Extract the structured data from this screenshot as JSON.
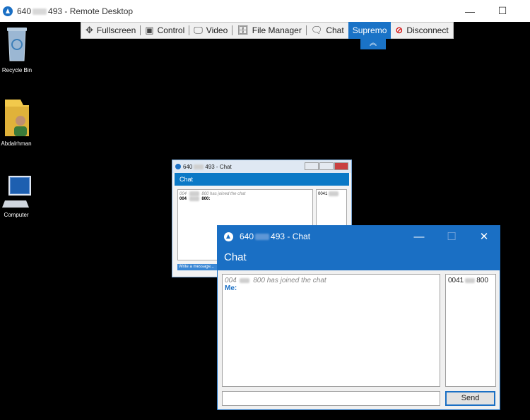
{
  "window": {
    "title_prefix": "640",
    "title_suffix": "493 - Remote Desktop",
    "minimize": "—",
    "maximize": "☐"
  },
  "toolbar": {
    "items": [
      {
        "icon": "move-icon",
        "glyph": "✥",
        "label": "Fullscreen"
      },
      {
        "icon": "control-icon",
        "glyph": "▣",
        "label": "Control"
      },
      {
        "icon": "monitor-icon",
        "glyph": "🖵",
        "label": "Video"
      },
      {
        "icon": "file-manager-icon",
        "glyph": "🗄",
        "label": "File Manager"
      },
      {
        "icon": "chat-icon",
        "glyph": "🗨",
        "label": "Chat"
      }
    ],
    "brand_label": "Supremo",
    "disconnect_label": "Disconnect",
    "collapse_glyph": "︽"
  },
  "desktop": {
    "icons": [
      {
        "name": "recycle-bin",
        "label": "Recycle Bin"
      },
      {
        "name": "user-folder",
        "label": "Abdalrhman"
      },
      {
        "name": "computer",
        "label": "Computer"
      }
    ]
  },
  "remote_chat": {
    "title_prefix": "640",
    "title_suffix": "493 - Chat",
    "header": "Chat",
    "joined_prefix": "004",
    "joined_suffix": "800 has joined the chat",
    "line2_prefix": "004",
    "line2_suffix": "800:",
    "user_prefix": "0041",
    "input_placeholder": "Write a message..."
  },
  "chat": {
    "title_prefix": "640",
    "title_suffix": "493 - Chat",
    "header": "Chat",
    "joined_prefix": "004",
    "joined_suffix": "800 has joined the chat",
    "me_label": "Me:",
    "user_prefix": "0041",
    "user_suffix": "800",
    "send_label": "Send",
    "minimize": "—",
    "maximize": "☐",
    "close": "✕"
  },
  "colors": {
    "accent": "#1a6fc4",
    "disconnect": "#d10000"
  }
}
